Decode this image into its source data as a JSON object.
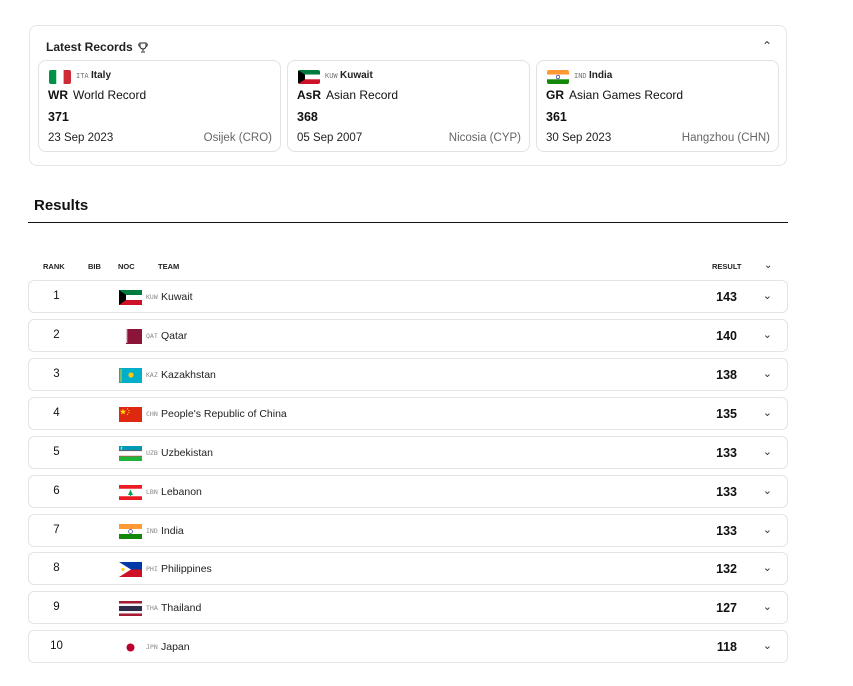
{
  "latest_records": {
    "title": "Latest Records",
    "trophy_icon": "trophy-icon",
    "chevron": "⌃",
    "cards": [
      {
        "noc": "ITA",
        "country": "Italy",
        "abbr": "WR",
        "record": "World Record",
        "value": "371",
        "date": "23 Sep 2023",
        "place": "Osijek (CRO)"
      },
      {
        "noc": "KUW",
        "country": "Kuwait",
        "abbr": "AsR",
        "record": "Asian Record",
        "value": "368",
        "date": "05 Sep 2007",
        "place": "Nicosia (CYP)"
      },
      {
        "noc": "IND",
        "country": "India",
        "abbr": "GR",
        "record": "Asian Games Record",
        "value": "361",
        "date": "30 Sep 2023",
        "place": "Hangzhou (CHN)"
      }
    ]
  },
  "results": {
    "title": "Results",
    "headers": {
      "rank": "RANK",
      "bib": "BIB",
      "noc": "NOC",
      "team": "TEAM",
      "result": "RESULT"
    },
    "chevron": "⌄",
    "rows": [
      {
        "rank": "1",
        "noc": "KUW",
        "team": "Kuwait",
        "result": "143"
      },
      {
        "rank": "2",
        "noc": "QAT",
        "team": "Qatar",
        "result": "140"
      },
      {
        "rank": "3",
        "noc": "KAZ",
        "team": "Kazakhstan",
        "result": "138"
      },
      {
        "rank": "4",
        "noc": "CHN",
        "team": "People's Republic of China",
        "result": "135"
      },
      {
        "rank": "5",
        "noc": "UZB",
        "team": "Uzbekistan",
        "result": "133"
      },
      {
        "rank": "6",
        "noc": "LBN",
        "team": "Lebanon",
        "result": "133"
      },
      {
        "rank": "7",
        "noc": "IND",
        "team": "India",
        "result": "133"
      },
      {
        "rank": "8",
        "noc": "PHI",
        "team": "Philippines",
        "result": "132"
      },
      {
        "rank": "9",
        "noc": "THA",
        "team": "Thailand",
        "result": "127"
      },
      {
        "rank": "10",
        "noc": "JPN",
        "team": "Japan",
        "result": "118"
      }
    ]
  }
}
